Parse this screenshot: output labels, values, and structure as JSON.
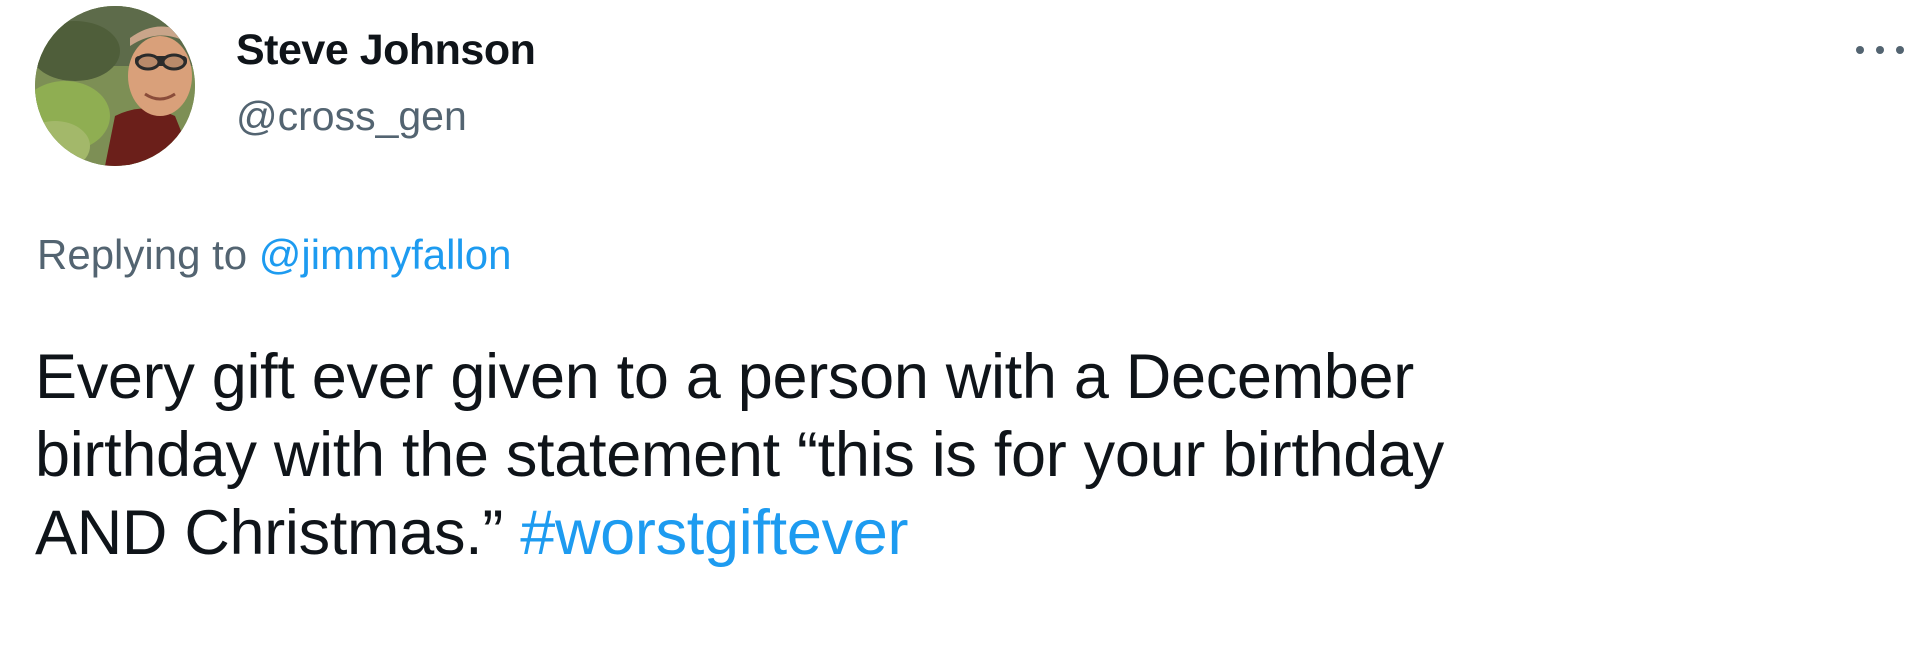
{
  "author": {
    "display_name": "Steve Johnson",
    "handle": "@cross_gen"
  },
  "more_menu": {
    "icon": "more-horizontal-icon"
  },
  "reply": {
    "prefix": "Replying to ",
    "mention": "@jimmyfallon"
  },
  "body": {
    "line1": "Every gift ever given to a person with a December",
    "line2": "birthday with the statement “this is for your birthday",
    "line3": "AND Christmas.” ",
    "hashtag": "#worstgiftever"
  },
  "colors": {
    "link": "#1d9bf0",
    "secondary_text": "#536471",
    "primary_text": "#0f1419"
  }
}
